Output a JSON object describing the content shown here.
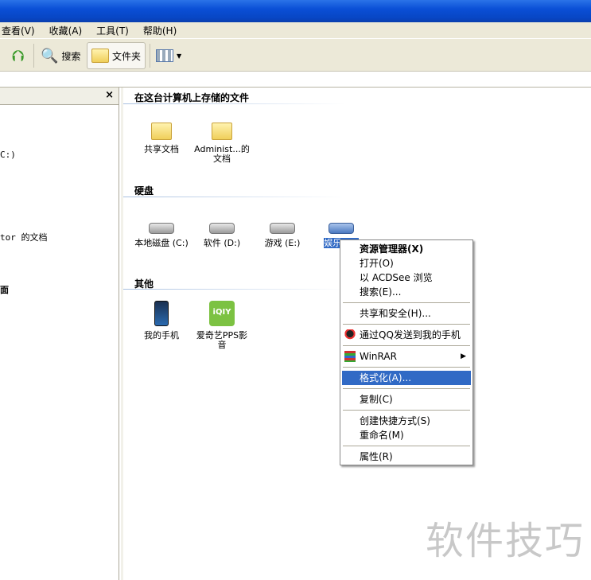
{
  "menubar": [
    "查看(V)",
    "收藏(A)",
    "工具(T)",
    "帮助(H)"
  ],
  "toolbar": {
    "search": "搜索",
    "folders": "文件夹"
  },
  "leftpane": {
    "items": [
      "C:)",
      "tor 的文档",
      "面"
    ]
  },
  "sections": {
    "stored": {
      "title": "在这台计算机上存储的文件",
      "items": [
        "共享文档",
        "Administ...的文档"
      ]
    },
    "drives": {
      "title": "硬盘",
      "items": [
        "本地磁盘 (C:)",
        "软件 (D:)",
        "游戏 (E:)",
        "娱乐 (F:)"
      ]
    },
    "other": {
      "title": "其他",
      "items": [
        "我的手机",
        "爱奇艺PPS影音"
      ]
    }
  },
  "context_menu": {
    "items": [
      "资源管理器(X)",
      "打开(O)",
      "以 ACDSee 浏览",
      "搜索(E)...",
      "共享和安全(H)...",
      "通过QQ发送到我的手机",
      "WinRAR",
      "格式化(A)...",
      "复制(C)",
      "创建快捷方式(S)",
      "重命名(M)",
      "属性(R)"
    ],
    "highlighted": "格式化(A)..."
  },
  "watermark": "软件技巧"
}
